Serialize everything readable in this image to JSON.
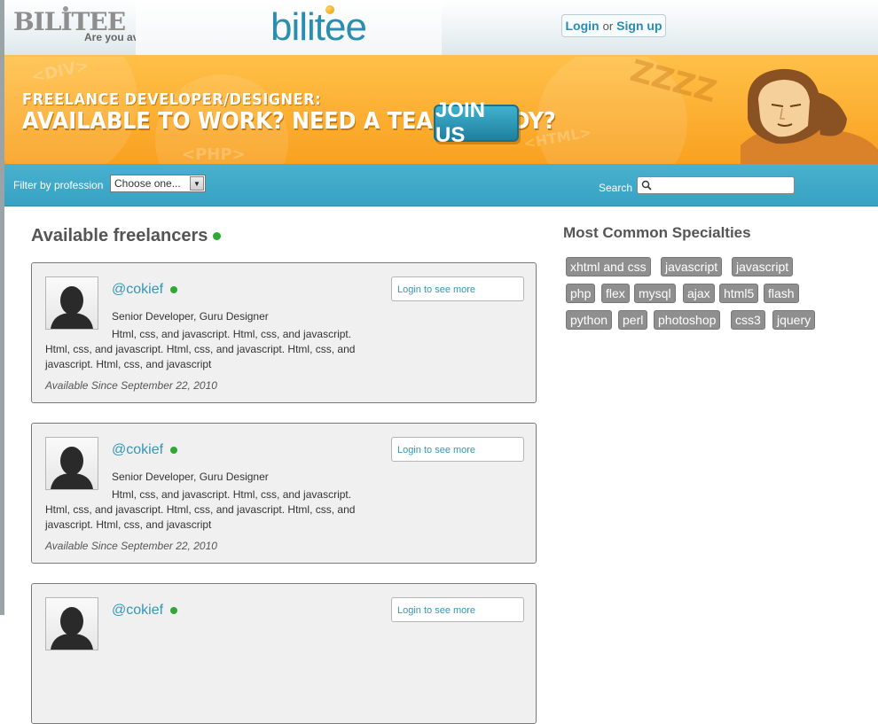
{
  "header": {
    "mini_logo": "BILITEE",
    "tagline": "Are you av",
    "logo": "bilitee",
    "login": "Login",
    "or": "or",
    "signup": "Sign up"
  },
  "banner": {
    "line1": "FREELANCE DEVELOPER/DESIGNER:",
    "line2": "AVAILABLE TO WORK? NEED A TEAM BUDDY?",
    "join": "JOIN US",
    "zzz": "ZZZZ",
    "deco_div": "<DIV>",
    "deco_php": "<PHP>",
    "deco_html": "<HTML>"
  },
  "filter": {
    "label": "Filter by profession",
    "selected": "Choose one...",
    "search_label": "Search"
  },
  "main": {
    "title": "Available freelancers",
    "freelancers": [
      {
        "handle": "@cokief",
        "role": "Senior Developer, Guru Designer",
        "desc1": "Html, css, and javascript. Html, css, and javascript.",
        "desc_rest": "Html, css, and javascript. Html, css, and javascript. Html, css, and javascript. Html, css, and javascript",
        "since": "Available Since September 22, 2010",
        "login_more": "Login to see more"
      },
      {
        "handle": "@cokief",
        "role": "Senior Developer, Guru Designer",
        "desc1": "Html, css, and javascript. Html, css, and javascript.",
        "desc_rest": "Html, css, and javascript. Html, css, and javascript. Html, css, and javascript. Html, css, and javascript",
        "since": "Available Since September 22, 2010",
        "login_more": "Login to see more"
      },
      {
        "handle": "@cokief",
        "role": "",
        "desc1": "",
        "desc_rest": "",
        "since": "",
        "login_more": "Login to see more"
      }
    ]
  },
  "sidebar": {
    "title": "Most Common Specialties",
    "tags": [
      "xhtml and css",
      "javascript",
      "javascript",
      "php",
      "flex",
      "mysql",
      "ajax",
      "html5",
      "flash",
      "python",
      "perl",
      "photoshop",
      "css3",
      "jquery"
    ]
  },
  "colors": {
    "accent": "#3596b8",
    "banner": "#f9a020",
    "filterbar": "#40a9c9",
    "online": "#2fa836",
    "tag": "#8f8f8f"
  }
}
